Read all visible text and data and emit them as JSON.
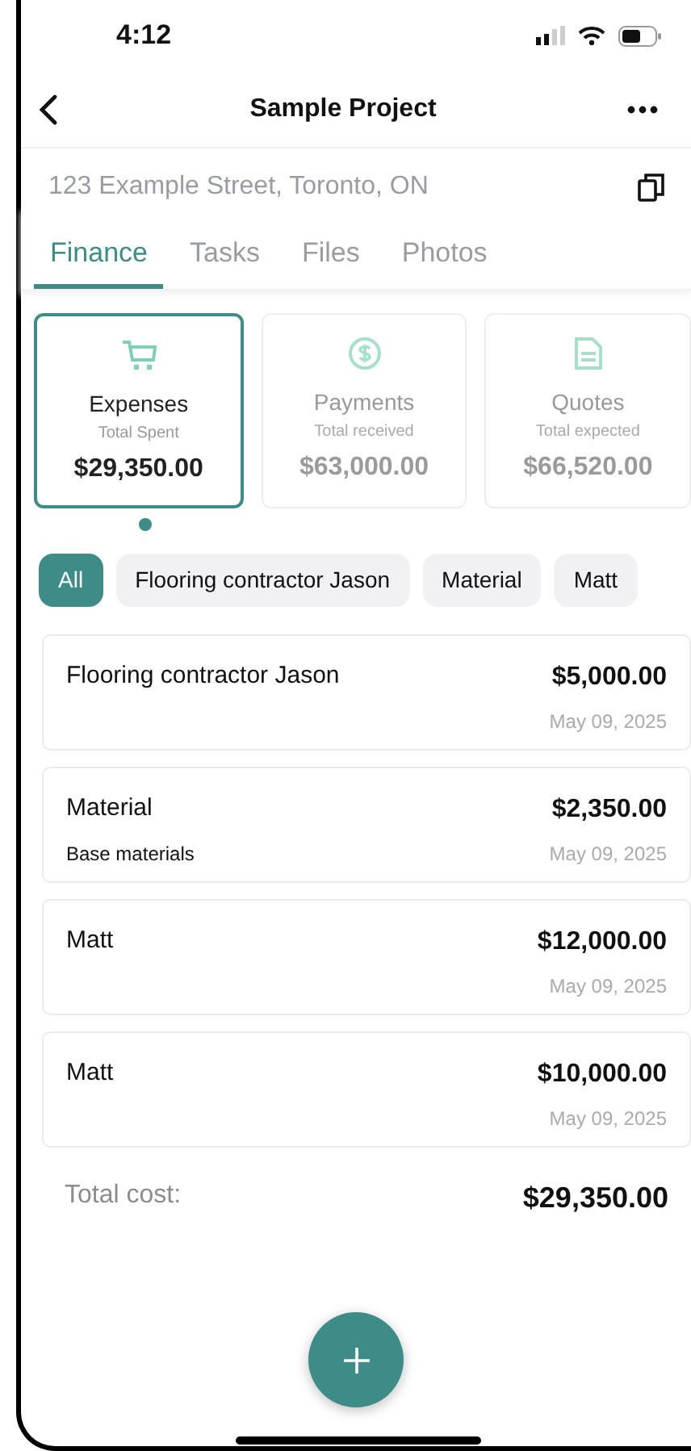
{
  "status_bar": {
    "time": "4:12"
  },
  "header": {
    "title": "Sample Project"
  },
  "address": "123 Example Street, Toronto, ON",
  "tabs": [
    {
      "label": "Finance",
      "selected": true
    },
    {
      "label": "Tasks",
      "selected": false
    },
    {
      "label": "Files",
      "selected": false
    },
    {
      "label": "Photos",
      "selected": false
    }
  ],
  "summary_cards": [
    {
      "kind": "cart",
      "title": "Expenses",
      "subtitle": "Total Spent",
      "amount": "$29,350.00",
      "selected": true
    },
    {
      "kind": "dollar",
      "title": "Payments",
      "subtitle": "Total received",
      "amount": "$63,000.00",
      "selected": false
    },
    {
      "kind": "document",
      "title": "Quotes",
      "subtitle": "Total expected",
      "amount": "$66,520.00",
      "selected": false
    }
  ],
  "filters": [
    {
      "label": "All",
      "selected": true
    },
    {
      "label": "Flooring contractor Jason",
      "selected": false
    },
    {
      "label": "Material",
      "selected": false
    },
    {
      "label": "Matt",
      "selected": false
    }
  ],
  "expenses": [
    {
      "name": "Flooring contractor Jason",
      "amount": "$5,000.00",
      "date": "May 09, 2025"
    },
    {
      "name": "Material",
      "note": "Base materials",
      "amount": "$2,350.00",
      "date": "May 09, 2025"
    },
    {
      "name": "Matt",
      "amount": "$12,000.00",
      "date": "May 09, 2025"
    },
    {
      "name": "Matt",
      "amount": "$10,000.00",
      "date": "May 09, 2025"
    }
  ],
  "total": {
    "label": "Total cost:",
    "amount": "$29,350.00"
  }
}
